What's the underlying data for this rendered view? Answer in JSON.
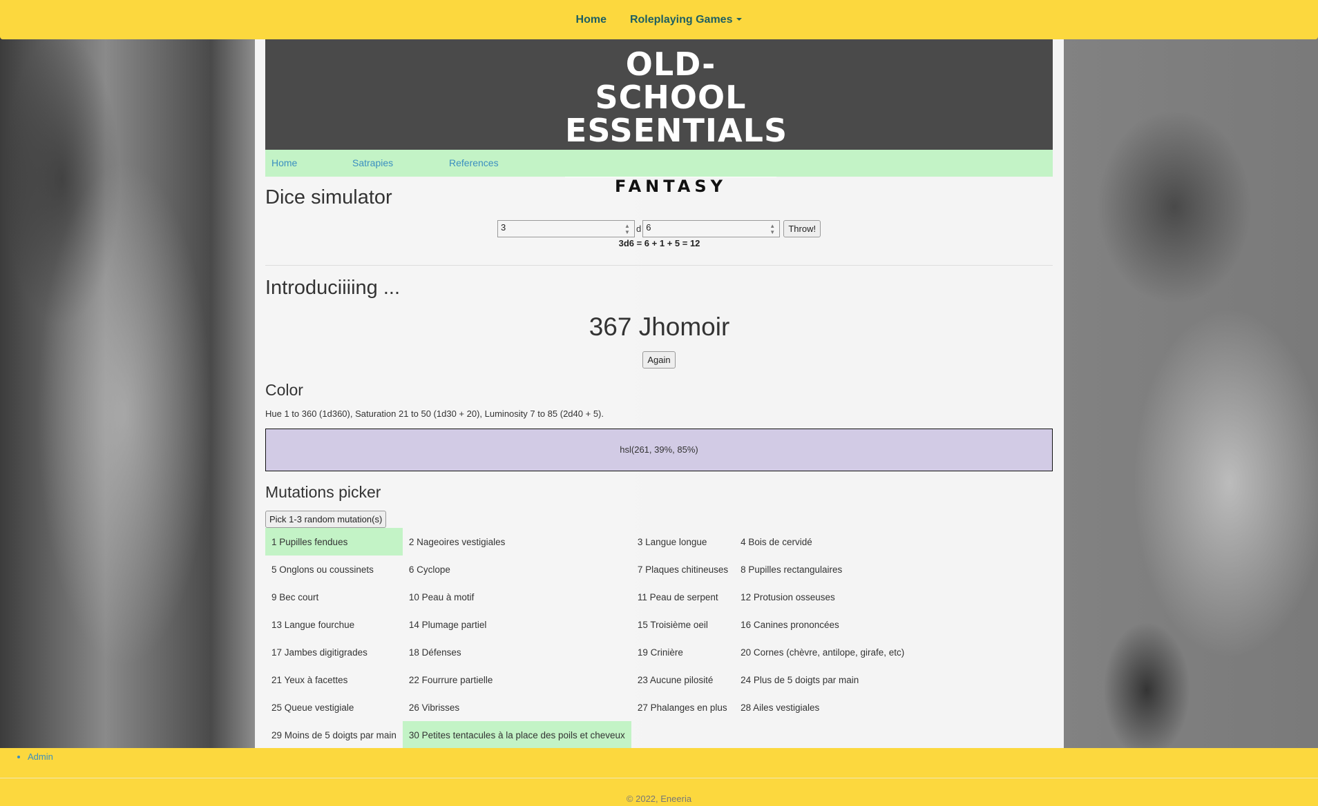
{
  "topnav": {
    "home": "Home",
    "rpg": "Roleplaying Games"
  },
  "logo": {
    "line1": "OLD-SCHOOL",
    "line2": "ESSENTIALS",
    "line3": "CLASSIC FANTASY"
  },
  "subnav": {
    "home": "Home",
    "satrapies": "Satrapies",
    "references": "References"
  },
  "dice": {
    "title": "Dice simulator",
    "count": "3",
    "separator": "d",
    "sides": "6",
    "throw_label": "Throw!",
    "result": "3d6 = 6 + 1 + 5 = 12"
  },
  "intro": {
    "title": "Introduciiiing ...",
    "creature": "367 Jhomoir",
    "again_label": "Again"
  },
  "color": {
    "title": "Color",
    "description": "Hue 1 to 360 (1d360), Saturation 21 to 50 (1d30 + 20), Luminosity 7 to 85 (2d40 + 5).",
    "value": "hsl(261, 39%, 85%)",
    "swatch": "#d2cbe5"
  },
  "mutations": {
    "title": "Mutations picker",
    "pick_label": "Pick 1-3 random mutation(s)",
    "rows": [
      [
        "1 Pupilles fendues",
        "2 Nageoires vestigiales",
        "3 Langue longue",
        "4 Bois de cervidé"
      ],
      [
        "5 Onglons ou coussinets",
        "6 Cyclope",
        "7 Plaques chitineuses",
        "8 Pupilles rectangulaires"
      ],
      [
        "9 Bec court",
        "10 Peau à motif",
        "11 Peau de serpent",
        "12 Protusion osseuses"
      ],
      [
        "13 Langue fourchue",
        "14 Plumage partiel",
        "15 Troisième oeil",
        "16 Canines prononcées"
      ],
      [
        "17 Jambes digitigrades",
        "18 Défenses",
        "19 Crinière",
        "20 Cornes (chèvre, antilope, girafe, etc)"
      ],
      [
        "21 Yeux à facettes",
        "22 Fourrure partielle",
        "23 Aucune pilosité",
        "24 Plus de 5 doigts par main"
      ],
      [
        "25 Queue vestigiale",
        "26 Vibrisses",
        "27 Phalanges en plus",
        "28 Ailes vestigiales"
      ],
      [
        "29 Moins de 5 doigts par main",
        "30 Petites tentacules à la place des poils et cheveux",
        "",
        ""
      ]
    ],
    "highlight_color": "#c3f3c6"
  },
  "footer": {
    "admin": "Admin",
    "copyright": "© 2022, Eneeria"
  },
  "colors": {
    "topbar": "#fcd83e",
    "nav_text": "#1e5f62",
    "link": "#3b8fc0",
    "banner": "#4a4a4a"
  }
}
